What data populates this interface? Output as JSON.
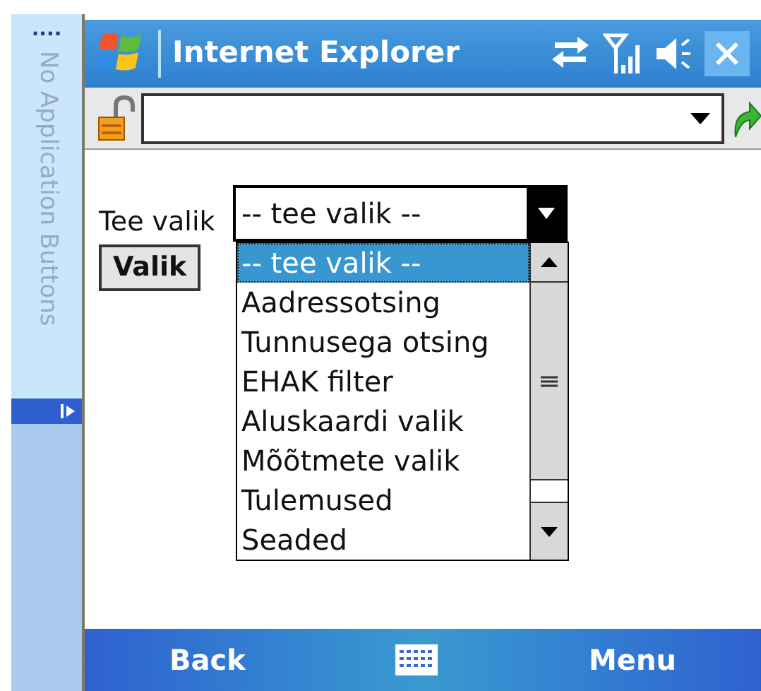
{
  "side_strip": {
    "dots": "....",
    "label": "No Application Buttons"
  },
  "window": {
    "title": "Internet Explorer"
  },
  "form": {
    "label": "Tee valik",
    "select_value": "-- tee valik --",
    "button": "Valik"
  },
  "dropdown": {
    "options": [
      {
        "label": "-- tee valik --",
        "selected": true
      },
      {
        "label": "Aadressotsing",
        "selected": false
      },
      {
        "label": "Tunnusega otsing",
        "selected": false
      },
      {
        "label": "EHAK filter",
        "selected": false
      },
      {
        "label": "Aluskaardi valik",
        "selected": false
      },
      {
        "label": "Mõõtmete valik",
        "selected": false
      },
      {
        "label": "Tulemused",
        "selected": false
      },
      {
        "label": "Seaded",
        "selected": false
      }
    ]
  },
  "softkeys": {
    "left": "Back",
    "right": "Menu"
  }
}
